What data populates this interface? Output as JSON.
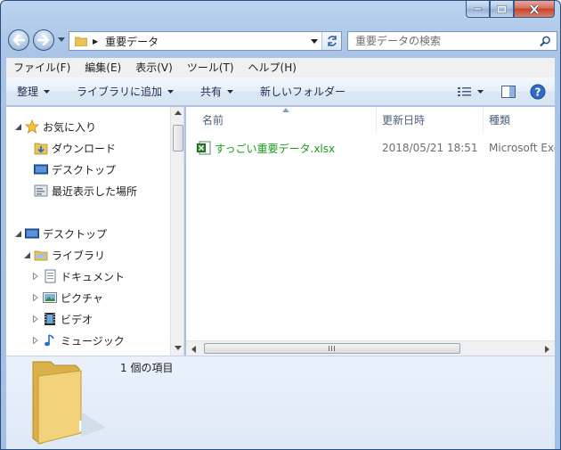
{
  "window": {
    "caption_buttons": [
      "minimize",
      "maximize",
      "close"
    ]
  },
  "address": {
    "path": "重要データ",
    "icon": "folder-icon"
  },
  "search": {
    "placeholder": "重要データの検索"
  },
  "menu": [
    "ファイル(F)",
    "編集(E)",
    "表示(V)",
    "ツール(T)",
    "ヘルプ(H)"
  ],
  "commands": {
    "organize": "整理",
    "add_to_library": "ライブラリに追加",
    "share": "共有",
    "new_folder": "新しいフォルダー"
  },
  "nav": {
    "favorites": "お気に入り",
    "downloads": "ダウンロード",
    "desktop_fav": "デスクトップ",
    "recent": "最近表示した場所",
    "desktop": "デスクトップ",
    "libraries": "ライブラリ",
    "documents": "ドキュメント",
    "pictures": "ピクチャ",
    "videos": "ビデオ",
    "music": "ミュージック"
  },
  "columns": {
    "name": "名前",
    "modified": "更新日時",
    "type": "種類"
  },
  "files": [
    {
      "name": "すっごい重要データ.xlsx",
      "modified": "2018/05/21 18:51",
      "type": "Microsoft Exc",
      "icon": "excel-file-icon"
    }
  ],
  "details": {
    "count_text": "1 個の項目"
  },
  "colors": {
    "file_name_green": "#1a9a1a",
    "window_frame": "#a9c4e6",
    "close_red": "#c7442a"
  }
}
